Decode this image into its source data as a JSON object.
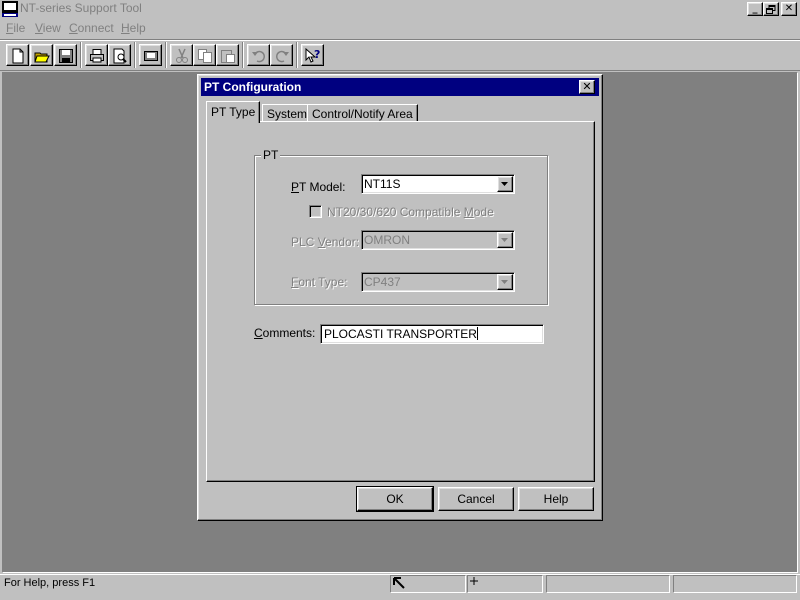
{
  "app": {
    "title": "NT-series Support Tool"
  },
  "menu": {
    "items": [
      {
        "label_ul": "F",
        "label_rest": "ile"
      },
      {
        "label_ul": "V",
        "label_rest": "iew"
      },
      {
        "label_ul": "C",
        "label_rest": "onnect"
      },
      {
        "label_ul": "H",
        "label_rest": "elp"
      }
    ]
  },
  "dialog": {
    "title": "PT Configuration",
    "tabs": [
      "PT Type",
      "System",
      "Control/Notify Area"
    ],
    "group_label": "PT",
    "pt_model": {
      "label_ul": "P",
      "label_rest": "T Model:",
      "value": "NT11S"
    },
    "compat": {
      "label_pre": "NT20/30/620 Compatible ",
      "label_ul": "M",
      "label_rest": "ode",
      "checked": false
    },
    "plc_vendor": {
      "label_pre": "PLC ",
      "label_ul": "V",
      "label_rest": "endor:",
      "value": "OMRON"
    },
    "font_type": {
      "label_ul": "F",
      "label_rest": "ont Type:",
      "value": "CP437"
    },
    "comments": {
      "label_ul": "C",
      "label_rest": "omments:",
      "value": "PLOCASTI TRANSPORTER"
    },
    "buttons": {
      "ok": "OK",
      "cancel": "Cancel",
      "help": "Help"
    }
  },
  "status": {
    "text": "For Help, press F1"
  },
  "icons": [
    "new-icon",
    "open-icon",
    "save-icon",
    "print-icon",
    "print-preview-icon",
    "transfer-icon",
    "cut-icon",
    "copy-icon",
    "paste-icon",
    "undo-icon",
    "redo-icon",
    "context-help-icon"
  ]
}
